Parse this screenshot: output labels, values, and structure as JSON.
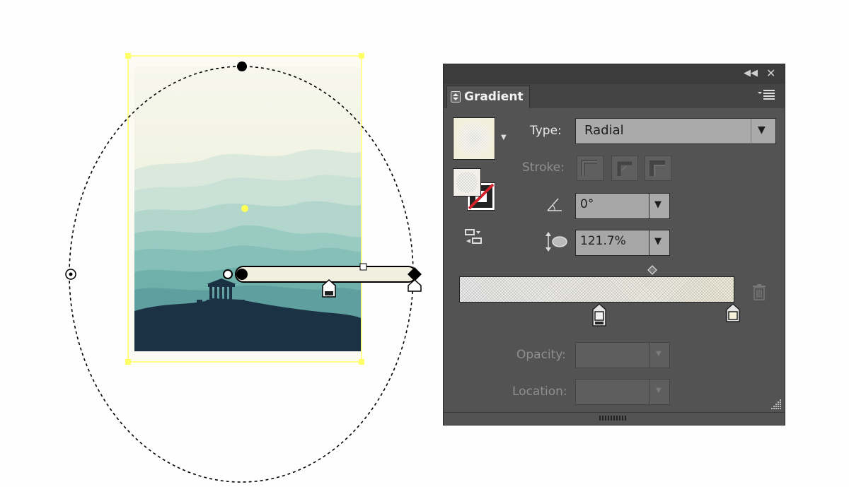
{
  "panel": {
    "tab_label": "Gradient",
    "collapse_icon": "double-chevron-left-icon",
    "close_icon": "close-icon",
    "menu_icon": "panel-menu-icon",
    "type_label": "Type:",
    "type_value": "Radial",
    "stroke_label": "Stroke:",
    "angle_icon": "angle-icon",
    "angle_value": "0°",
    "aspect_icon": "aspect-ratio-icon",
    "aspect_value": "121.7%",
    "opacity_label": "Opacity:",
    "location_label": "Location:",
    "delete_icon": "trash-icon"
  },
  "gradient": {
    "type": "radial",
    "stops": [
      {
        "color": "#f0f0f0",
        "location": 50
      },
      {
        "color": "#f4f0da",
        "location": 100
      }
    ]
  },
  "colors": {
    "panel_bg": "#535353",
    "selection": "#ffff66",
    "sky": "#eef1de",
    "mountain": "#8fc6bd",
    "silhouette": "#1b3244"
  }
}
